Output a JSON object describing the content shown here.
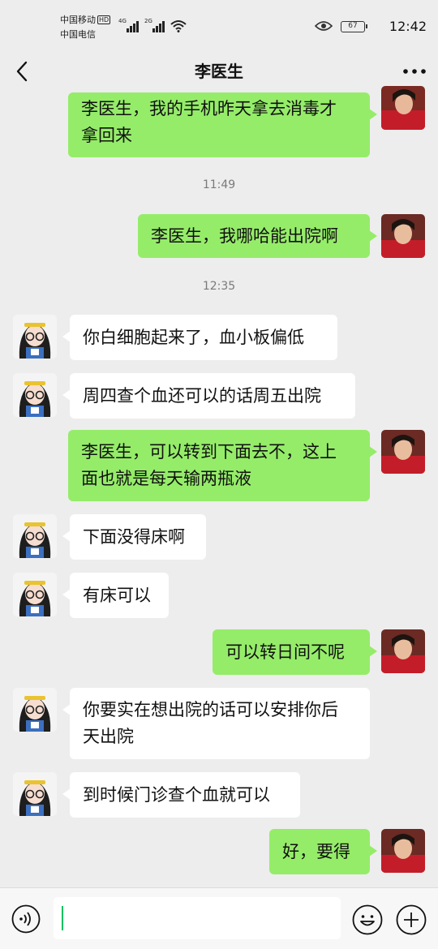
{
  "status_bar": {
    "carrier_1": "中国移动",
    "carrier_1_badge": "HD",
    "carrier_2": "中国电信",
    "signal_1_label": "4G",
    "signal_2_label": "2G",
    "battery": "67",
    "time": "12:42"
  },
  "header": {
    "title": "李医生"
  },
  "timestamps": [
    "11:49",
    "12:35"
  ],
  "messages": [
    {
      "side": "sent",
      "text_lines": [
        "李医生，我的手机昨天拿去消毒才",
        "拿回来"
      ]
    },
    {
      "side": "sent",
      "text_lines": [
        "李医生，我哪哈能出院啊"
      ]
    },
    {
      "side": "recv",
      "text_lines": [
        "你白细胞起来了，血小板偏低"
      ]
    },
    {
      "side": "recv",
      "text_lines": [
        "周四查个血还可以的话周五出院"
      ]
    },
    {
      "side": "sent",
      "text_lines": [
        "李医生，可以转到下面去不，这上",
        "面也就是每天输两瓶液"
      ]
    },
    {
      "side": "recv",
      "text_lines": [
        "下面没得床啊"
      ]
    },
    {
      "side": "recv",
      "text_lines": [
        "有床可以"
      ]
    },
    {
      "side": "sent",
      "text_lines": [
        "可以转日间不呢"
      ]
    },
    {
      "side": "recv",
      "text_lines": [
        "你要实在想出院的话可以安排你后",
        "天出院"
      ]
    },
    {
      "side": "recv",
      "text_lines": [
        "到时候门诊查个血就可以"
      ]
    },
    {
      "side": "sent",
      "text_lines": [
        "好，要得"
      ]
    }
  ],
  "input": {
    "value": "",
    "placeholder": ""
  },
  "colors": {
    "sent_bubble": "#95ec69",
    "recv_bubble": "#ffffff",
    "background": "#ededed",
    "caret": "#07c160"
  },
  "icons": {
    "back": "chevron-left-icon",
    "more": "more-dots-icon",
    "voice": "voice-icon",
    "emoji": "emoji-icon",
    "plus": "plus-icon",
    "eye": "eye-icon",
    "wifi": "wifi-icon"
  }
}
